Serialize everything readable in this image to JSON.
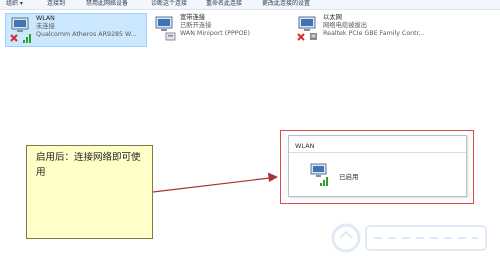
{
  "toolbar": {
    "items": [
      "组织 ▾",
      "连接到",
      "禁用此网络设备",
      "诊断这个连接",
      "重命名此连接",
      "更改此连接的设置"
    ]
  },
  "connections": [
    {
      "name": "WLAN",
      "status": "未连接",
      "adapter": "Qualcomm Atheros AR9285 W...",
      "selected": true,
      "icon": "wifi-disconnected-icon"
    },
    {
      "name": "宽带连接",
      "status": "已断开连接",
      "adapter": "WAN Miniport (PPPOE)",
      "selected": false,
      "icon": "broadband-icon"
    },
    {
      "name": "以太网",
      "status": "网络电缆被拔出",
      "adapter": "Realtek PCIe GBE Family Contr...",
      "selected": false,
      "icon": "ethernet-disconnected-icon"
    }
  ],
  "callout": {
    "text": "启用后：连接网络即可使用"
  },
  "popup": {
    "title": "WLAN",
    "status": "已启用"
  },
  "colors": {
    "accent_red": "#e24a4a",
    "selection_bg": "#cce8ff",
    "note_bg": "#ffffc8"
  }
}
